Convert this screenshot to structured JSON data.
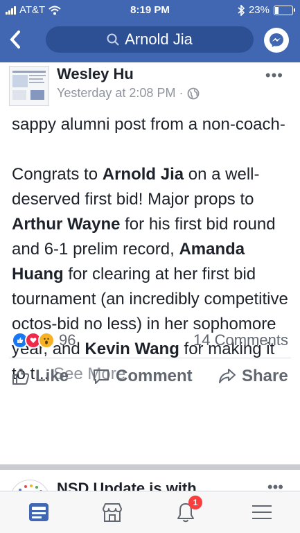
{
  "status_bar": {
    "carrier": "AT&T",
    "time": "8:19 PM",
    "battery": "23%"
  },
  "header": {
    "search_text": "Arnold Jia"
  },
  "post": {
    "author": "Wesley Hu",
    "timestamp": "Yesterday at 2:08 PM ·",
    "more_label": "•••",
    "line1": "sappy alumni post from a non-coach-",
    "p2_a": "Congrats to ",
    "p2_b": "Arnold Jia",
    "p2_c": " on a well-deserved first bid! Major props to ",
    "p2_d": "Arthur Wayne",
    "p2_e": " for his first bid round and 6-1 prelim record, ",
    "p2_f": "Amanda Huang",
    "p2_g": " for clearing at her first bid tournament (an incredibly competitive octos-bid no less) in her sophomore year, and ",
    "p2_h": "Kevin Wang",
    "p2_i": " for making it to t...",
    "see_more": "See More",
    "reaction_count": "96",
    "comments": "14 Comments",
    "like_label": "Like",
    "comment_label": "Comment",
    "share_label": "Share"
  },
  "next_post": {
    "author": "NSD Update is with",
    "more_label": "•••"
  },
  "tabbar": {
    "notifications_badge": "1"
  },
  "colors": {
    "fb_blue": "#4267b2",
    "like_blue": "#1877f2",
    "love_red": "#f0284a",
    "wow_yellow": "#f7b125"
  }
}
